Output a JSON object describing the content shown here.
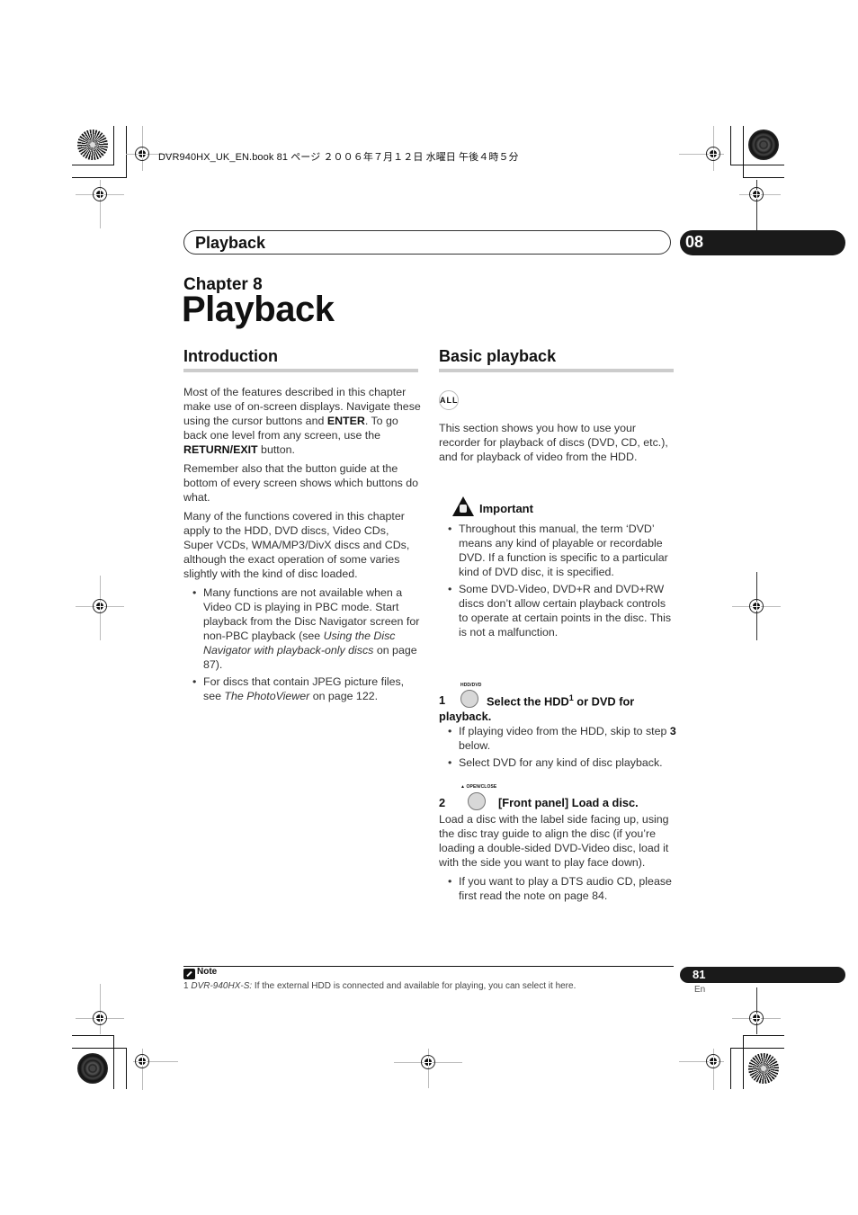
{
  "print_header": {
    "file_info": "DVR940HX_UK_EN.book  81 ページ  ２００６年７月１２日  水曜日  午後４時５分"
  },
  "running_header": {
    "section": "Playback",
    "chapter_number": "08"
  },
  "chapter": {
    "label": "Chapter 8",
    "title": "Playback"
  },
  "introduction": {
    "heading": "Introduction",
    "p1": {
      "t1": "Most of the features described in this chapter make use of on-screen displays. Navigate these using the cursor buttons and ",
      "b1": "ENTER",
      "t2": ". To go back one level from any screen, use the ",
      "b2": "RETURN/EXIT",
      "t3": " button."
    },
    "p2": "Remember also that the button guide at the bottom of every screen shows which buttons do what.",
    "p3": "Many of the functions covered in this chapter apply to the HDD, DVD discs, Video CDs, Super VCDs, WMA/MP3/DivX discs and CDs, although the exact operation of some varies slightly with the kind of disc loaded.",
    "bullets": [
      {
        "t1": "Many functions are not available when a Video CD is playing in PBC mode. Start playback from the Disc Navigator screen for non-PBC playback (see ",
        "i1": "Using the Disc Navigator with playback-only discs",
        "t2": " on page 87)."
      },
      {
        "t1": "For discs that contain JPEG picture files, see ",
        "i1": "The PhotoViewer",
        "t2": " on page 122."
      }
    ]
  },
  "basic_playback": {
    "heading": "Basic playback",
    "badge": "ALL",
    "intro": "This section shows you how to use your recorder for playback of discs (DVD, CD, etc.), and for playback of video from the HDD.",
    "important": {
      "title": "Important",
      "bullets": [
        "Throughout this manual, the term ‘DVD’ means any kind of playable or recordable DVD. If a function is specific to a particular kind of DVD disc, it is specified.",
        "Some DVD-Video, DVD+R and DVD+RW discs don’t allow certain playback controls to operate at certain points in the disc. This is not a malfunction."
      ]
    },
    "steps": [
      {
        "number": "1",
        "button_label": "HDD/DVD",
        "title_a": "Select the HDD",
        "footnote": "1",
        "title_b": " or DVD for",
        "title_c": "playback.",
        "bullets": [
          {
            "t1": "If playing video from the HDD, skip to step ",
            "b1": "3",
            "t2": " below."
          },
          {
            "t1": "Select DVD for any kind of disc playback.",
            "b1": "",
            "t2": ""
          }
        ]
      },
      {
        "number": "2",
        "button_label": "▲ OPEN/CLOSE",
        "title": "[Front panel] Load a disc.",
        "body": "Load a disc with the label side facing up, using the disc tray guide to align the disc (if you’re loading a double-sided DVD-Video disc, load it with the side you want to play face down).",
        "bullets": [
          "If you want to play a DTS audio CD, please first read the note on page 84."
        ]
      }
    ]
  },
  "footnote": {
    "title": "Note",
    "number": "1",
    "model": "DVR-940HX-S:",
    "text": " If the external HDD is connected and available for playing, you can select it here."
  },
  "page": {
    "number": "81",
    "language": "En"
  },
  "icons": {
    "registration_mark": "crosshair-circle",
    "star_target": "radial-star",
    "important": "warning-triangle-hand",
    "note": "pencil-note"
  }
}
